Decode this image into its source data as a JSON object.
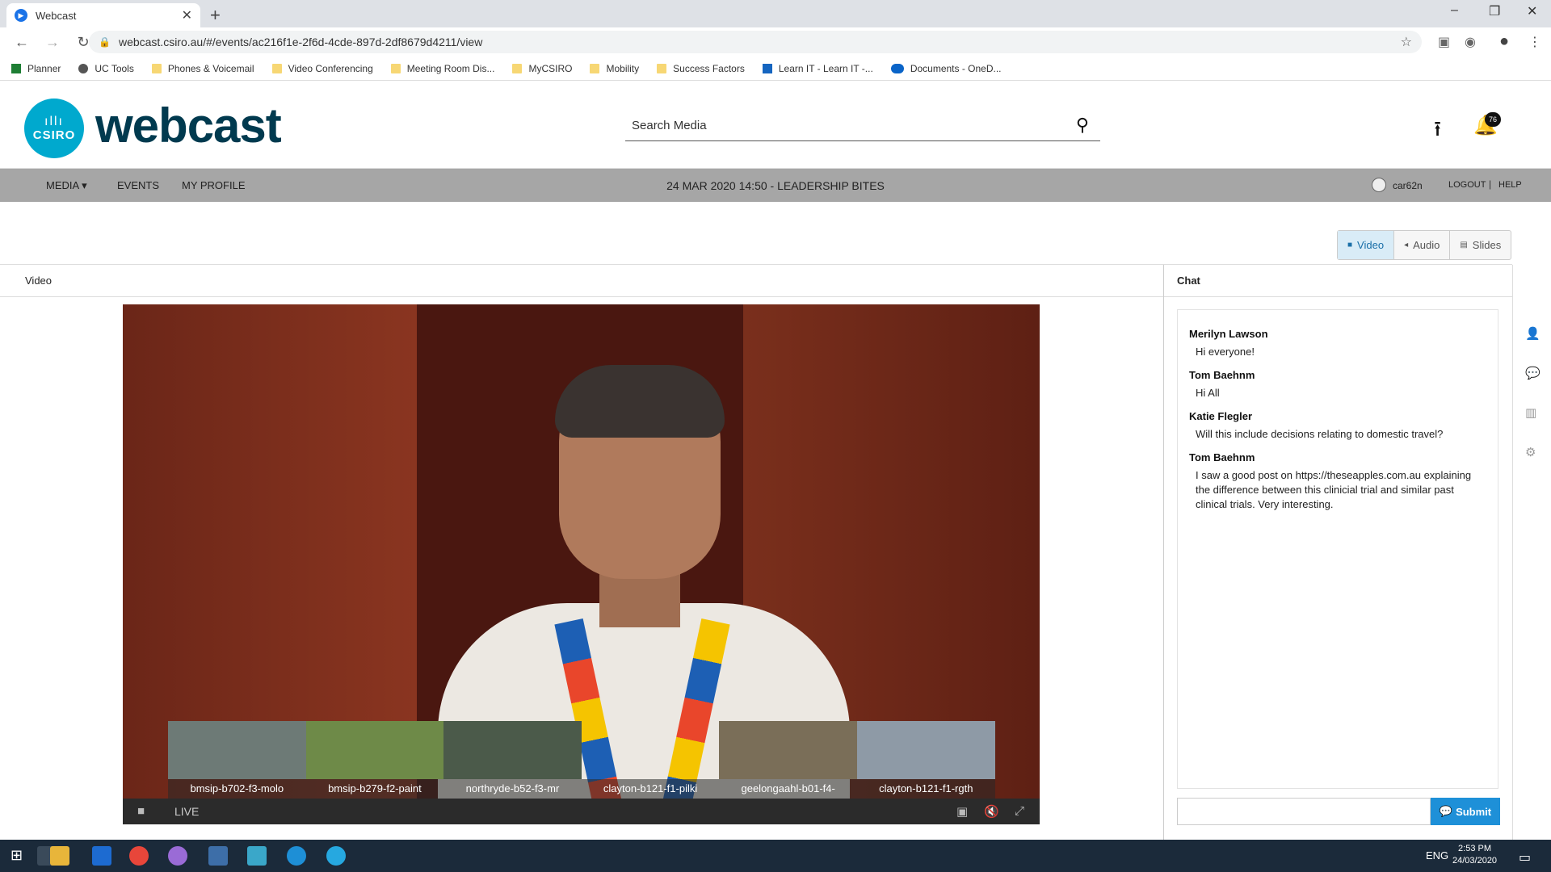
{
  "browser": {
    "tab_title": "Webcast",
    "tab_close": "✕",
    "new_tab": "+",
    "url": "webcast.csiro.au/#/events/ac216f1e-2f6d-4cde-897d-2df8679d4211/view",
    "bookmarks": [
      {
        "label": "Planner",
        "icon": "planner-icon"
      },
      {
        "label": "UC Tools",
        "icon": "globe-icon"
      },
      {
        "label": "Phones & Voicemail",
        "icon": "folder-icon"
      },
      {
        "label": "Video Conferencing",
        "icon": "folder-icon"
      },
      {
        "label": "Meeting Room Dis...",
        "icon": "folder-icon"
      },
      {
        "label": "MyCSIRO",
        "icon": "folder-icon"
      },
      {
        "label": "Mobility",
        "icon": "folder-icon"
      },
      {
        "label": "Success Factors",
        "icon": "folder-icon"
      },
      {
        "label": "Learn IT - Learn IT -...",
        "icon": "confluence-icon"
      },
      {
        "label": "Documents - OneD...",
        "icon": "onedrive-icon"
      }
    ]
  },
  "header": {
    "logo_text": "CSIRO",
    "brand": "webcast",
    "search_placeholder": "Search Media",
    "notifications_count": "76"
  },
  "nav": {
    "media": "MEDIA ▾",
    "events": "EVENTS",
    "profile": "MY PROFILE",
    "event_title": "24 MAR 2020 14:50 - LEADERSHIP BITES",
    "username": "car62n",
    "logout": "LOGOUT",
    "help": "HELP"
  },
  "modes": {
    "video": "Video",
    "audio": "Audio",
    "slides": "Slides",
    "active": "video"
  },
  "video_panel": {
    "title": "Video",
    "live_label": "LIVE",
    "thumbnails": [
      {
        "label": "bmsip-b702-f3-molo",
        "color": "#6d7a76"
      },
      {
        "label": "bmsip-b279-f2-paint",
        "color": "#6e8a48"
      },
      {
        "label": "northryde-b52-f3-mr",
        "color": "#4b5a4a"
      },
      {
        "label": "clayton-b121-f1-pilki",
        "color": "#d9cdbd"
      },
      {
        "label": "geelongaahl-b01-f4-",
        "color": "#7a6e58"
      },
      {
        "label": "clayton-b121-f1-rgth",
        "color": "#8e9aa6"
      }
    ]
  },
  "chat": {
    "title": "Chat",
    "messages": [
      {
        "author": "Merilyn Lawson",
        "text": "Hi everyone!"
      },
      {
        "author": "Tom Baehnm",
        "text": "Hi All"
      },
      {
        "author": "Katie Flegler",
        "text": "Will this include decisions relating to domestic travel?"
      },
      {
        "author": "Tom Baehnm",
        "text": "I saw a good post on https://theseapples.com.au explaining the difference between this clinicial trial and similar past clinical trials.  Very interesting."
      }
    ],
    "input_value": "",
    "submit_label": "Submit"
  },
  "taskbar": {
    "language": "ENG",
    "time": "2:53 PM",
    "date": "24/03/2020"
  },
  "colors": {
    "brand_dark": "#003a4f",
    "logo_blue": "#00a9ce",
    "nav_gray": "#a6a6a6",
    "submit_blue": "#1e90d8"
  }
}
